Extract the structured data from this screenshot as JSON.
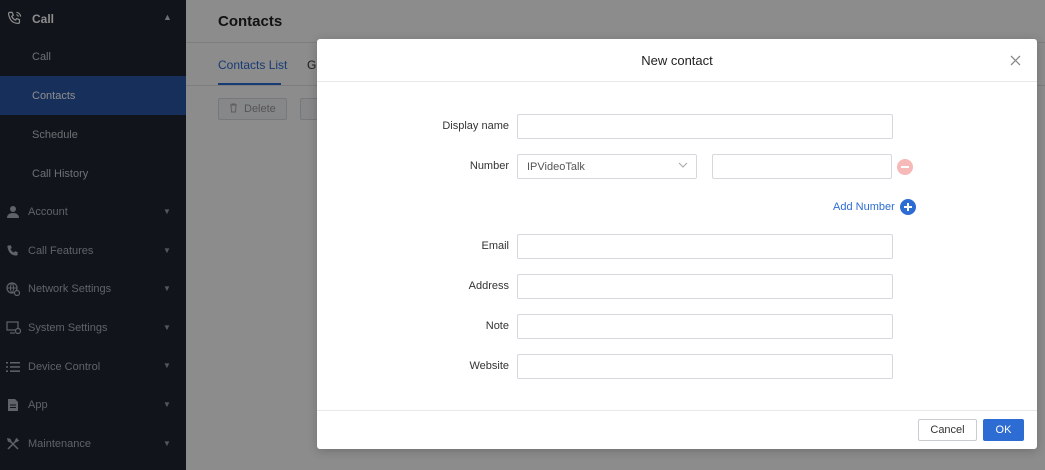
{
  "sidebar": {
    "top": {
      "label": "Call",
      "icon": "phone-icon"
    },
    "sub_items": [
      {
        "label": "Call",
        "active": false
      },
      {
        "label": "Contacts",
        "active": true
      },
      {
        "label": "Schedule",
        "active": false
      },
      {
        "label": "Call History",
        "active": false
      }
    ],
    "groups": [
      {
        "label": "Account",
        "icon": "user-icon"
      },
      {
        "label": "Call Features",
        "icon": "phone-icon"
      },
      {
        "label": "Network Settings",
        "icon": "globe-icon"
      },
      {
        "label": "System Settings",
        "icon": "monitor-settings-icon"
      },
      {
        "label": "Device Control",
        "icon": "list-icon"
      },
      {
        "label": "App",
        "icon": "document-icon"
      },
      {
        "label": "Maintenance",
        "icon": "tools-icon"
      }
    ]
  },
  "page": {
    "title": "Contacts",
    "tabs": [
      {
        "label": "Contacts List",
        "active": true
      },
      {
        "label": "Gr",
        "active": false
      }
    ],
    "toolbar": {
      "delete_label": "Delete"
    }
  },
  "modal": {
    "title": "New contact",
    "fields": {
      "display_name": {
        "label": "Display name",
        "value": ""
      },
      "number": {
        "label": "Number",
        "type_value": "IPVideoTalk",
        "value": ""
      },
      "email": {
        "label": "Email",
        "value": ""
      },
      "address": {
        "label": "Address",
        "value": ""
      },
      "note": {
        "label": "Note",
        "value": ""
      },
      "website": {
        "label": "Website",
        "value": ""
      }
    },
    "add_number_label": "Add Number",
    "cancel_label": "Cancel",
    "ok_label": "OK"
  },
  "colors": {
    "accent": "#2d6cd3",
    "sidebar_bg": "#1f2631",
    "sidebar_active": "#2b57a6",
    "remove": "#f7b8b8"
  }
}
